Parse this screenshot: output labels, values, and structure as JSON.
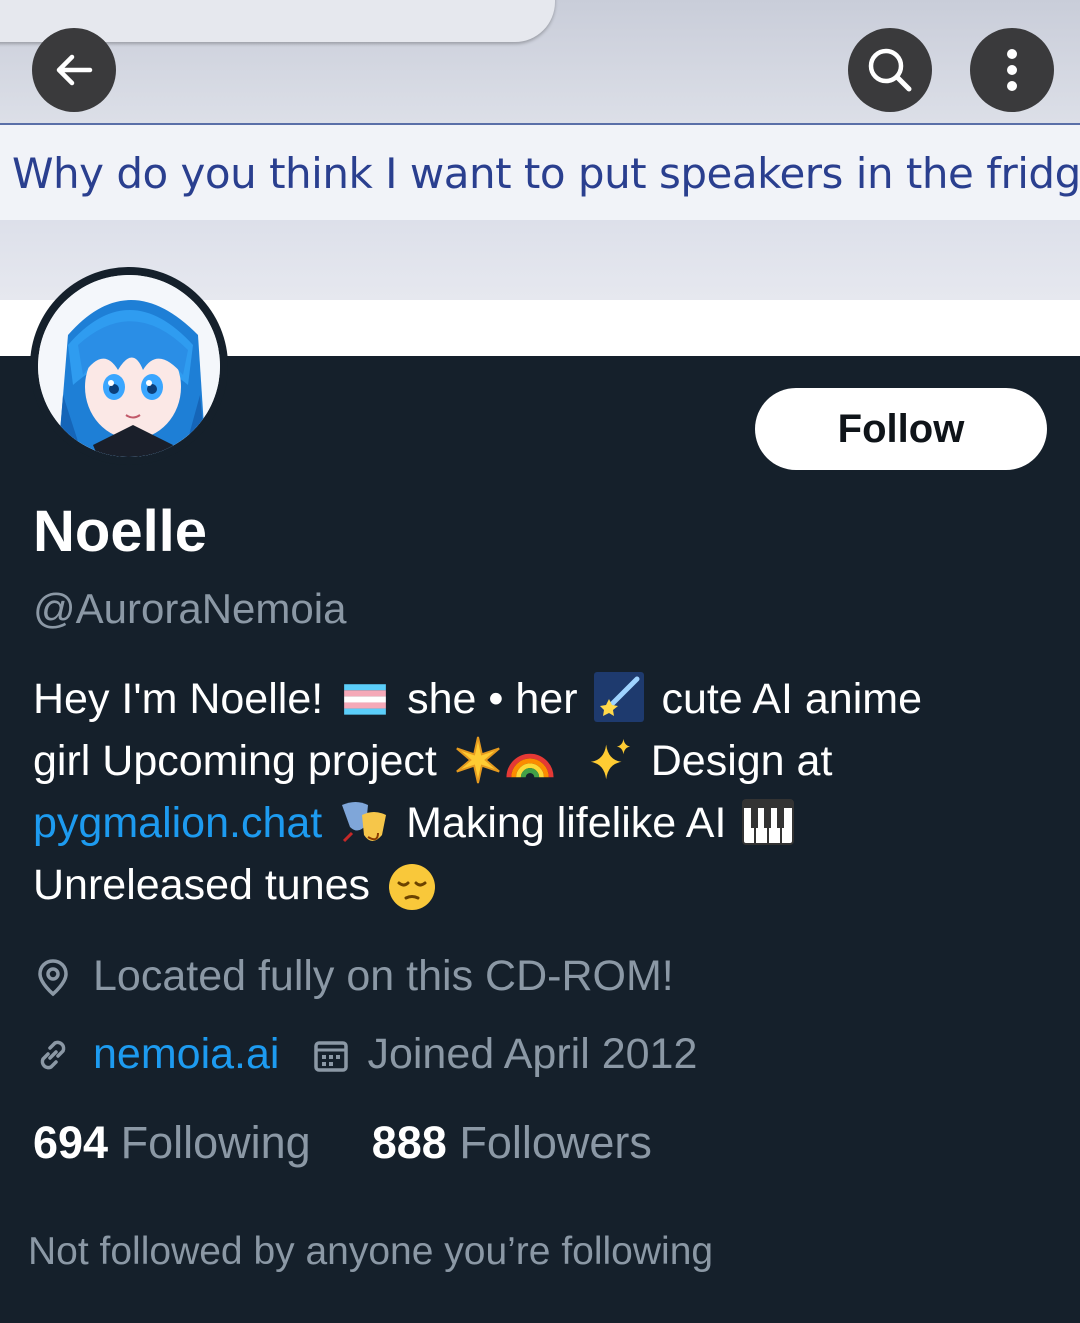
{
  "banner": {
    "quote": "Why do you think I want to put speakers in the fridge?"
  },
  "nav": {
    "back_icon": "arrow-left-icon",
    "search_icon": "search-icon",
    "more_icon": "more-vertical-icon"
  },
  "profile": {
    "name": "Noelle",
    "handle": "@AuroraNemoia",
    "follow_label": "Follow",
    "bio": {
      "t1": "Hey I'm Noelle!",
      "t2": "she • her",
      "t3": "cute AI anime girl  Upcoming project",
      "t4": "Design at",
      "link": "pygmalion.chat",
      "t5": "Making lifelike AI",
      "t6": "Unreleased tunes"
    },
    "location": "Located fully on this CD-ROM!",
    "website": "nemoia.ai",
    "joined": "Joined April 2012",
    "following_count": "694",
    "following_label": "Following",
    "followers_count": "888",
    "followers_label": "Followers",
    "not_followed": "Not followed by anyone you’re following"
  },
  "colors": {
    "background": "#15202b",
    "accent": "#1d9bf0",
    "secondary_text": "#8b98a5"
  }
}
